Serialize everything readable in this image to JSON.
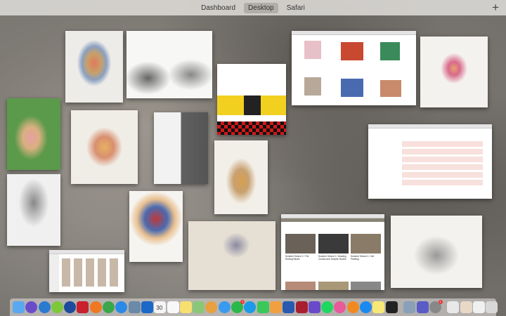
{
  "spaces": {
    "items": [
      {
        "label": "Dashboard"
      },
      {
        "label": "Desktop",
        "active": true
      },
      {
        "label": "Safari"
      }
    ],
    "add_label": "+"
  },
  "windows": {
    "safari_site": {
      "courses": [
        {
          "title": "Summer School 1 / The Etching Studio"
        },
        {
          "title": "Summer School 1 / Drawing Comics and Graphic Novels"
        },
        {
          "title": "Summer School 1 / Life Painting"
        }
      ]
    }
  },
  "dock": {
    "apps": [
      {
        "name": "Finder",
        "icon": "finder-icon",
        "color": "#5aa8f0"
      },
      {
        "name": "Siri",
        "icon": "siri-icon",
        "color": "#6a4cc8"
      },
      {
        "name": "App",
        "icon": "figure-icon",
        "color": "#2a7ad0"
      },
      {
        "name": "Dragon",
        "icon": "dragon-icon",
        "color": "#7cc83a"
      },
      {
        "name": "App",
        "icon": "person-icon",
        "color": "#1c4a9c"
      },
      {
        "name": "App",
        "icon": "red-app-icon",
        "color": "#c8202c"
      },
      {
        "name": "Firefox",
        "icon": "firefox-icon",
        "color": "#f07820"
      },
      {
        "name": "Chrome",
        "icon": "chrome-icon",
        "color": "#3aa84a"
      },
      {
        "name": "Safari",
        "icon": "safari-icon",
        "color": "#2a8ae8"
      },
      {
        "name": "Preview",
        "icon": "preview-icon",
        "color": "#6a8aa8"
      },
      {
        "name": "Outlook",
        "icon": "outlook-icon",
        "color": "#1a68c8"
      },
      {
        "name": "Calendar",
        "icon": "calendar-icon",
        "color": "#f4f4f4",
        "text": "30"
      },
      {
        "name": "Reminders",
        "icon": "reminders-icon",
        "color": "#f8f8f8"
      },
      {
        "name": "Notes",
        "icon": "notes-icon",
        "color": "#f8e070"
      },
      {
        "name": "Maps",
        "icon": "maps-icon",
        "color": "#8ac878"
      },
      {
        "name": "Photos",
        "icon": "photos-icon",
        "color": "#e8a040"
      },
      {
        "name": "Messages",
        "icon": "messages-icon",
        "color": "#3a9af0"
      },
      {
        "name": "WhatsApp",
        "icon": "whatsapp-icon",
        "color": "#2ab84a",
        "badge": "1"
      },
      {
        "name": "Skype",
        "icon": "skype-icon",
        "color": "#1a9ae8"
      },
      {
        "name": "FaceTime",
        "icon": "facetime-icon",
        "color": "#3ac85a"
      },
      {
        "name": "Pages",
        "icon": "pages-icon",
        "color": "#f0a040"
      },
      {
        "name": "Word",
        "icon": "word-icon",
        "color": "#2a5ab0"
      },
      {
        "name": "Photo Booth",
        "icon": "photobooth-icon",
        "color": "#a82030"
      },
      {
        "name": "iMovie",
        "icon": "imovie-icon",
        "color": "#6a4ac8"
      },
      {
        "name": "Spotify",
        "icon": "spotify-icon",
        "color": "#1ed760"
      },
      {
        "name": "iTunes",
        "icon": "itunes-icon",
        "color": "#e85a9a"
      },
      {
        "name": "iBooks",
        "icon": "ibooks-icon",
        "color": "#f08a20"
      },
      {
        "name": "App Store",
        "icon": "appstore-icon",
        "color": "#1a8af0"
      },
      {
        "name": "Stickies",
        "icon": "stickies-icon",
        "color": "#f8e878"
      },
      {
        "name": "App",
        "icon": "play-icon",
        "color": "#222222"
      },
      {
        "name": "Image Capture",
        "icon": "image-capture-icon",
        "color": "#8aa0b8"
      },
      {
        "name": "Teams",
        "icon": "teams-icon",
        "color": "#5a5ac8"
      },
      {
        "name": "System Preferences",
        "icon": "gear-icon",
        "color": "#888888",
        "badge": "1"
      },
      {
        "name": "Document",
        "icon": "document-icon",
        "color": "#e8e8e8"
      },
      {
        "name": "Document",
        "icon": "document-icon",
        "color": "#e8d8c8"
      },
      {
        "name": "Document",
        "icon": "document-icon",
        "color": "#f0f0f0"
      },
      {
        "name": "Trash",
        "icon": "trash-icon",
        "color": "#d8d8d8"
      }
    ]
  }
}
